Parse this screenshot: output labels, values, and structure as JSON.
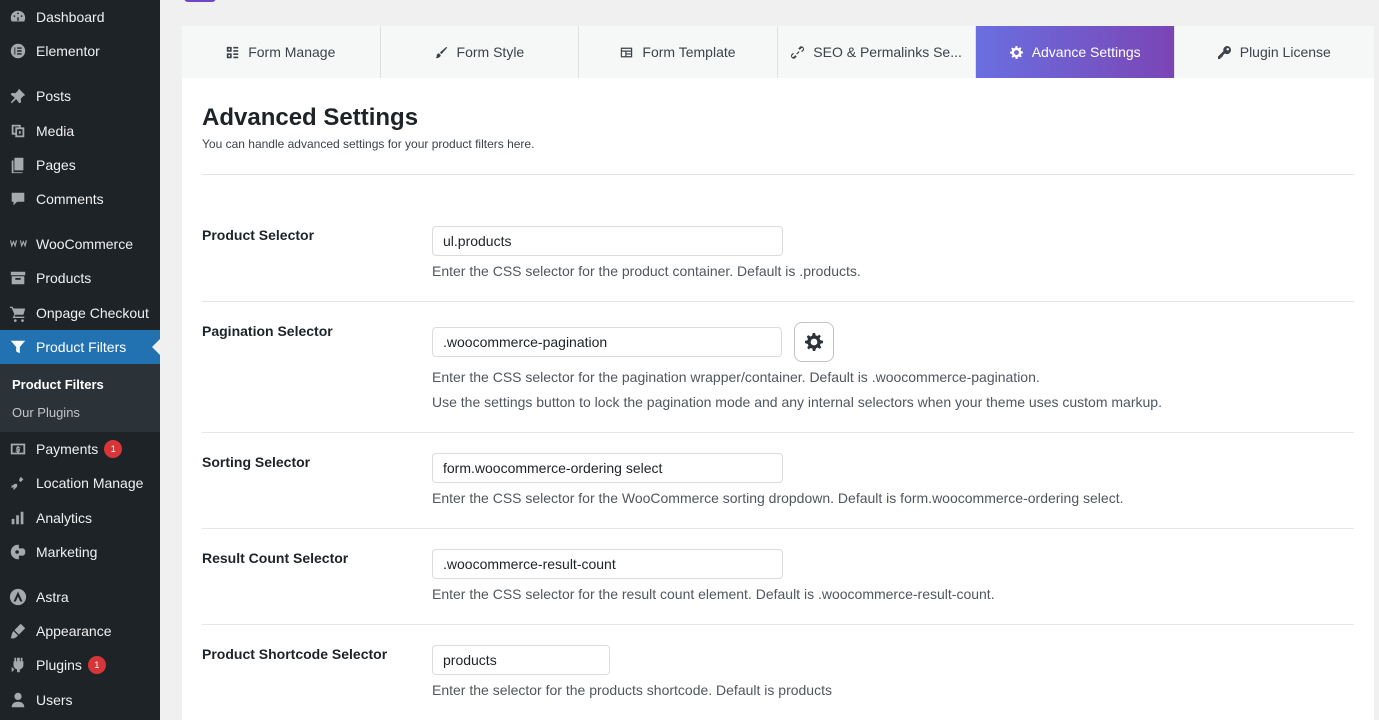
{
  "sidebar": {
    "items": [
      {
        "label": "Dashboard",
        "icon": "dashboard-icon"
      },
      {
        "label": "Elementor",
        "icon": "elementor-icon"
      },
      {
        "label": "Posts",
        "icon": "pin-icon"
      },
      {
        "label": "Media",
        "icon": "media-icon"
      },
      {
        "label": "Pages",
        "icon": "pages-icon"
      },
      {
        "label": "Comments",
        "icon": "comment-icon"
      },
      {
        "label": "WooCommerce",
        "icon": "woocommerce-icon"
      },
      {
        "label": "Products",
        "icon": "archive-icon"
      },
      {
        "label": "Onpage Checkout",
        "icon": "cart-icon"
      },
      {
        "label": "Product Filters",
        "icon": "filter-icon"
      },
      {
        "label": "Payments",
        "icon": "payments-icon",
        "badge": "1"
      },
      {
        "label": "Location Manage",
        "icon": "location-icon"
      },
      {
        "label": "Analytics",
        "icon": "bar-chart-icon"
      },
      {
        "label": "Marketing",
        "icon": "megaphone-icon"
      },
      {
        "label": "Astra",
        "icon": "astra-icon"
      },
      {
        "label": "Appearance",
        "icon": "paintbrush-icon"
      },
      {
        "label": "Plugins",
        "icon": "plug-icon",
        "badge": "1"
      },
      {
        "label": "Users",
        "icon": "user-icon"
      }
    ],
    "submenu": [
      {
        "label": "Product Filters"
      },
      {
        "label": "Our Plugins"
      }
    ],
    "active_color": "#2271b1"
  },
  "tabs": [
    {
      "label": "Form Manage",
      "icon": "form-manage-icon"
    },
    {
      "label": "Form Style",
      "icon": "brush-icon"
    },
    {
      "label": "Form Template",
      "icon": "template-icon"
    },
    {
      "label": "SEO & Permalinks Se...",
      "icon": "link-icon"
    },
    {
      "label": "Advance Settings",
      "icon": "gear-icon"
    },
    {
      "label": "Plugin License",
      "icon": "key-icon"
    }
  ],
  "page": {
    "title": "Advanced Settings",
    "subtitle": "You can handle advanced settings for your product filters here."
  },
  "settings": [
    {
      "label": "Product Selector",
      "value": "ul.products",
      "help": "Enter the CSS selector for the product container. Default is .products."
    },
    {
      "label": "Pagination Selector",
      "value": ".woocommerce-pagination",
      "help": "Enter the CSS selector for the pagination wrapper/container. Default is .woocommerce-pagination.",
      "help2": "Use the settings button to lock the pagination mode and any internal selectors when your theme uses custom markup."
    },
    {
      "label": "Sorting Selector",
      "value": "form.woocommerce-ordering select",
      "help": "Enter the CSS selector for the WooCommerce sorting dropdown. Default is form.woocommerce-ordering select."
    },
    {
      "label": "Result Count Selector",
      "value": ".woocommerce-result-count",
      "help": "Enter the CSS selector for the result count element. Default is .woocommerce-result-count."
    },
    {
      "label": "Product Shortcode Selector",
      "value": "products",
      "help": "Enter the selector for the products shortcode. Default is products"
    }
  ],
  "colors": {
    "sidebar_bg": "#1d2327",
    "tab_active_gradient_start": "#6a6fe0",
    "tab_active_gradient_end": "#7b45b5",
    "badge": "#d63638"
  }
}
